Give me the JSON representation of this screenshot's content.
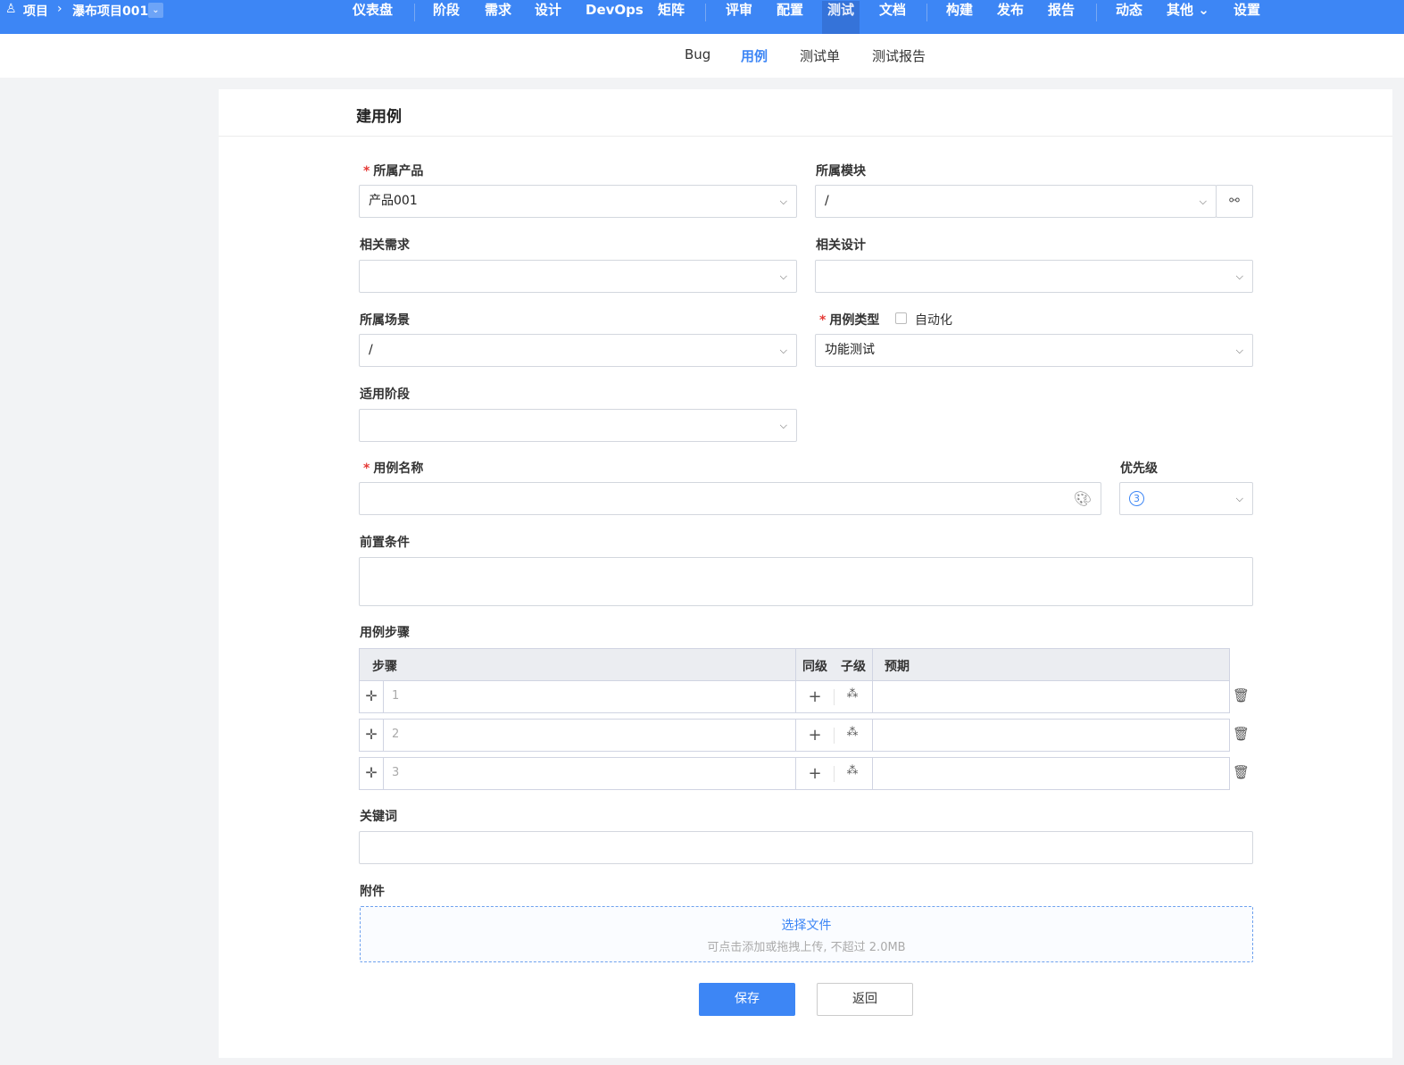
{
  "topbar": {
    "breadcrumb": [
      "项目",
      "瀑布项目001"
    ],
    "nav": [
      "仪表盘",
      "阶段",
      "需求",
      "设计",
      "DevOps",
      "矩阵",
      "评审",
      "配置",
      "测试",
      "文档",
      "构建",
      "发布",
      "报告",
      "动态",
      "其他",
      "设置"
    ],
    "active": "测试"
  },
  "subnav": {
    "items": [
      "Bug",
      "用例",
      "测试单",
      "测试报告"
    ],
    "active": "用例"
  },
  "form": {
    "title": "建用例",
    "product": {
      "label": "所属产品",
      "value": "产品001"
    },
    "module": {
      "label": "所属模块",
      "value": "/"
    },
    "story": {
      "label": "相关需求",
      "value": ""
    },
    "design": {
      "label": "相关设计",
      "value": ""
    },
    "scene": {
      "label": "所属场景",
      "value": "/"
    },
    "type": {
      "label": "用例类型",
      "auto_label": "自动化",
      "value": "功能测试"
    },
    "stage": {
      "label": "适用阶段",
      "value": ""
    },
    "name": {
      "label": "用例名称",
      "value": ""
    },
    "priority": {
      "label": "优先级",
      "value": "3"
    },
    "precondition": {
      "label": "前置条件"
    },
    "steps": {
      "label": "用例步骤",
      "col_step": "步骤",
      "col_sibling": "同级",
      "col_child": "子级",
      "col_expect": "预期",
      "rows": [
        "1",
        "2",
        "3"
      ]
    },
    "keywords": {
      "label": "关键词"
    },
    "attachment": {
      "label": "附件",
      "choose": "选择文件",
      "hint": "可点击添加或拖拽上传, 不超过 2.0MB"
    },
    "save": "保存",
    "back": "返回"
  },
  "colors": {
    "primary": "#3d86f5",
    "required": "#e53935"
  }
}
